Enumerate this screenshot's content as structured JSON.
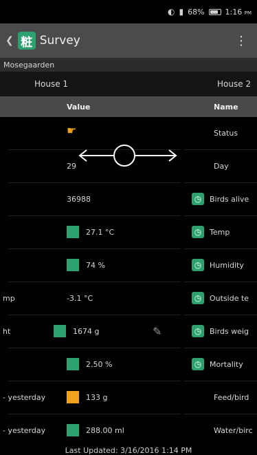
{
  "status_bar": {
    "battery": "68%",
    "time": "1:16",
    "ampm": "PM"
  },
  "app_bar": {
    "title": "Survey",
    "icon": "survey-grid-icon"
  },
  "farm": {
    "name": "Mosegaarden"
  },
  "houses": [
    "House 1",
    "House 2"
  ],
  "columns": {
    "value": "Value",
    "name": "Name"
  },
  "rows": [
    {
      "label": "",
      "value": "",
      "indicator": "hand-pointer-icon",
      "name": "Status",
      "clock": false
    },
    {
      "label": "",
      "value": "29",
      "indicator": "",
      "name": "Day",
      "clock": false
    },
    {
      "label": "",
      "value": "36988",
      "indicator": "",
      "name": "Birds alive",
      "clock": true
    },
    {
      "label": "",
      "value": "27.1 °C",
      "indicator": "green",
      "name": "Temp",
      "clock": true
    },
    {
      "label": "",
      "value": "74 %",
      "indicator": "green",
      "name": "Humidity",
      "clock": true
    },
    {
      "label": "mp",
      "value": "-3.1 °C",
      "indicator": "",
      "name": "Outside te",
      "clock": true
    },
    {
      "label": "ht",
      "value": "1674 g",
      "indicator": "green",
      "name": "Birds weig",
      "clock": true
    },
    {
      "label": "",
      "value": "2.50 %",
      "indicator": "green",
      "name": "Mortality",
      "clock": true
    },
    {
      "label": "- yesterday",
      "value": "133 g",
      "indicator": "orange",
      "name": "Feed/bird",
      "clock": false
    },
    {
      "label": "- yesterday",
      "value": "288.00 ml",
      "indicator": "green",
      "name": "Water/birc",
      "clock": false
    }
  ],
  "footer": {
    "last_updated": "Last Updated: 3/16/2016 1:14 PM"
  },
  "colors": {
    "accent_green": "#2aa16e",
    "warning_orange": "#f0a21a",
    "app_bar": "#4b4b4b"
  }
}
